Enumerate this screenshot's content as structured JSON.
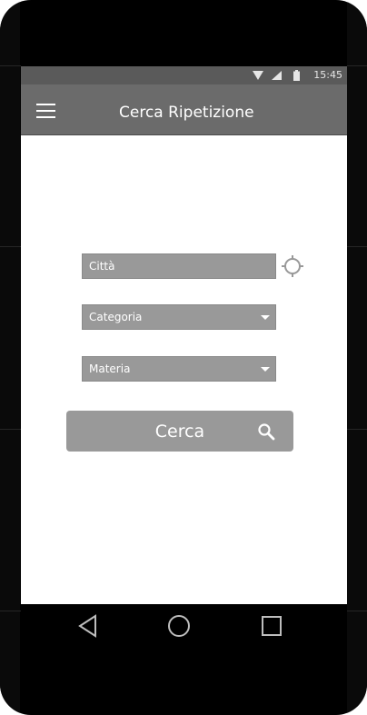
{
  "statusbar": {
    "time": "15:45",
    "wifi_icon": "wifi-icon",
    "signal_icon": "signal-icon",
    "battery_icon": "battery-icon"
  },
  "appbar": {
    "title": "Cerca Ripetizione",
    "menu_icon": "hamburger-menu-icon"
  },
  "form": {
    "city": {
      "label": "Città",
      "locate_icon": "crosshair-icon"
    },
    "category": {
      "label": "Categoria"
    },
    "subject": {
      "label": "Materia"
    },
    "search": {
      "label": "Cerca",
      "icon": "search-icon"
    }
  },
  "navbar": {
    "back_icon": "back-icon",
    "home_icon": "home-icon",
    "recents_icon": "recents-icon"
  },
  "colors": {
    "appbar": "#6b6b6b",
    "statusbar": "#5a5a5a",
    "field": "#999999",
    "button": "#999999"
  }
}
